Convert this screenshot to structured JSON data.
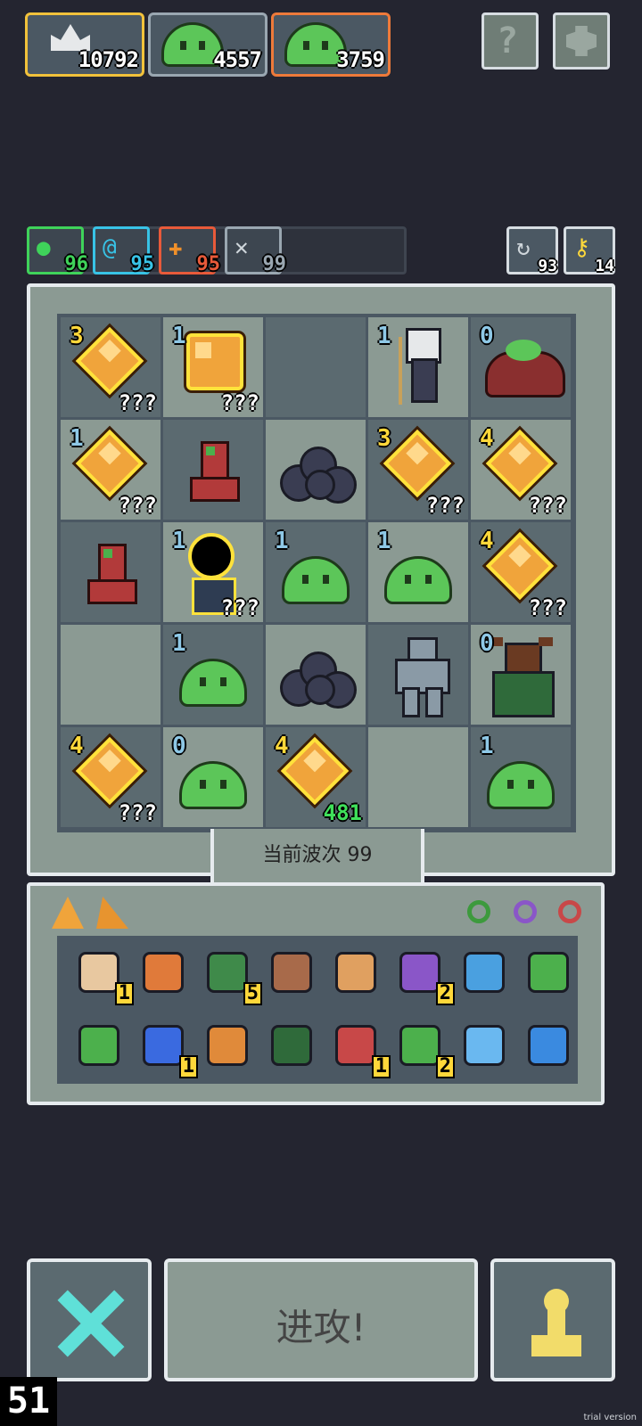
{
  "resources": [
    {
      "name": "crown",
      "value": "10792",
      "border": "#f2c23b"
    },
    {
      "name": "slime",
      "value": "4557",
      "border": "#b8c3c8"
    },
    {
      "name": "slime",
      "value": "3759",
      "border": "#ee7a3a"
    }
  ],
  "top_buttons": {
    "help_icon": "question-icon",
    "settings_icon": "gear-icon"
  },
  "stats": [
    {
      "icon": "heart-icon",
      "value": "96",
      "color": "#3fd35a"
    },
    {
      "icon": "mana-icon",
      "value": "95",
      "color": "#38c3e6"
    },
    {
      "icon": "attack-icon",
      "value": "95",
      "color": "#e85a3a"
    },
    {
      "icon": "wings-icon",
      "value": "99",
      "color": "#9aa7b1"
    }
  ],
  "right_stats": [
    {
      "icon": "refresh-icon",
      "value": "93"
    },
    {
      "icon": "key-icon",
      "value": "14"
    }
  ],
  "board": {
    "rows": [
      [
        {
          "t": "gem",
          "lvl": "3",
          "q": "???"
        },
        {
          "t": "gem-big",
          "lvl": "1",
          "q": "???"
        },
        {
          "t": "empty"
        },
        {
          "t": "wizard",
          "lvl": "1"
        },
        {
          "t": "bush",
          "lvl": "0"
        }
      ],
      [
        {
          "t": "gem",
          "lvl": "1",
          "q": "???"
        },
        {
          "t": "boot"
        },
        {
          "t": "rocks"
        },
        {
          "t": "gem",
          "lvl": "3",
          "q": "???"
        },
        {
          "t": "gem",
          "lvl": "4",
          "q": "???"
        }
      ],
      [
        {
          "t": "boot"
        },
        {
          "t": "portal",
          "lvl": "1",
          "q": "???"
        },
        {
          "t": "slime",
          "lvl": "1"
        },
        {
          "t": "slime",
          "lvl": "1"
        },
        {
          "t": "gem",
          "lvl": "4",
          "q": "???"
        }
      ],
      [
        {
          "t": "empty"
        },
        {
          "t": "slime",
          "lvl": "1"
        },
        {
          "t": "rocks"
        },
        {
          "t": "golem"
        },
        {
          "t": "minotaur",
          "lvl": "0"
        }
      ],
      [
        {
          "t": "gem",
          "lvl": "4",
          "q": "???"
        },
        {
          "t": "slime",
          "lvl": "0"
        },
        {
          "t": "gem",
          "lvl": "4",
          "q": "481"
        },
        {
          "t": "empty"
        },
        {
          "t": "slime",
          "lvl": "1"
        }
      ]
    ]
  },
  "wave_label": "当前波次 99",
  "inventory": {
    "rings": [
      "ring-green-icon",
      "ring-purple-icon",
      "ring-red-icon"
    ],
    "row1": [
      {
        "icon": "drum-icon",
        "count": "1"
      },
      {
        "icon": "armor-icon"
      },
      {
        "icon": "goblin-icon",
        "count": "5"
      },
      {
        "icon": "slingshot-icon"
      },
      {
        "icon": "crown-icon"
      },
      {
        "icon": "potion-icon",
        "count": "2"
      },
      {
        "icon": "feather-icon"
      },
      {
        "icon": "sword-icon"
      }
    ],
    "row2": [
      {
        "icon": "axe-icon"
      },
      {
        "icon": "hourglass-icon",
        "count": "1"
      },
      {
        "icon": "sickle-icon"
      },
      {
        "icon": "map-icon"
      },
      {
        "icon": "anchor-icon",
        "count": "1"
      },
      {
        "icon": "snake-icon",
        "count": "2"
      },
      {
        "icon": "crystal-icon"
      },
      {
        "icon": "wave-icon"
      }
    ]
  },
  "attack_label": "进攻!",
  "counter": "51",
  "watermark": "trial version"
}
